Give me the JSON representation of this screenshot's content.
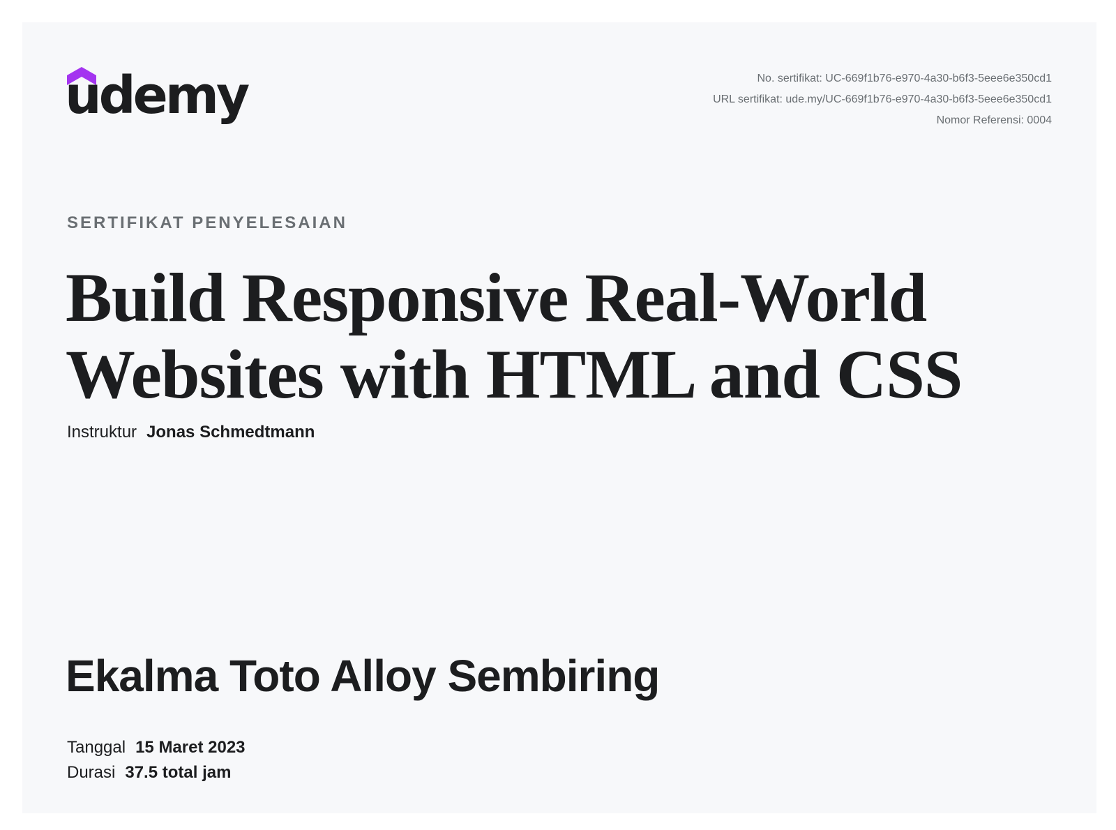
{
  "brand": {
    "logo_text": "udemy",
    "accent_color": "#a435f0"
  },
  "certificate_meta": {
    "number": "No. sertifikat: UC-669f1b76-e970-4a30-b6f3-5eee6e350cd1",
    "url": "URL sertifikat: ude.my/UC-669f1b76-e970-4a30-b6f3-5eee6e350cd1",
    "reference": "Nomor Referensi: 0004"
  },
  "certificate": {
    "eyebrow": "SERTIFIKAT PENYELESAIAN",
    "course_title": "Build Responsive Real-World Websites with HTML and CSS",
    "instructor_label": "Instruktur",
    "instructor_name": "Jonas Schmedtmann",
    "student_name": "Ekalma Toto Alloy Sembiring",
    "date_label": "Tanggal",
    "date_value": "15 Maret 2023",
    "duration_label": "Durasi",
    "duration_value": "37.5 total jam"
  }
}
